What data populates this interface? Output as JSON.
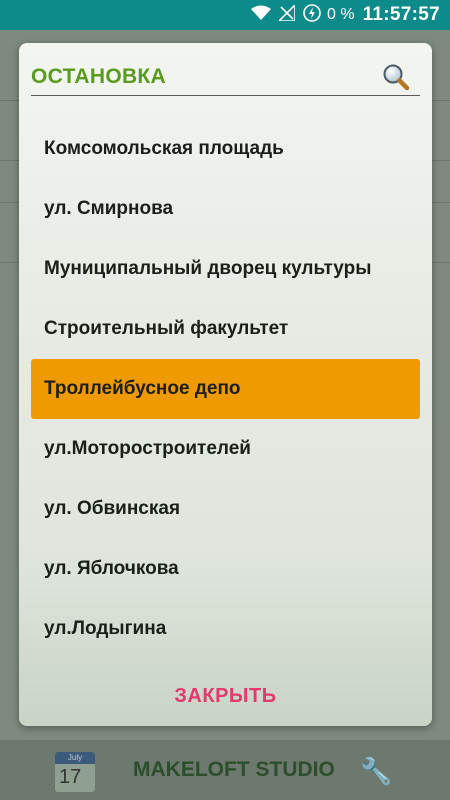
{
  "status_bar": {
    "battery_percent": "0 %",
    "time": "11:57:57"
  },
  "dialog": {
    "title": "ОСТАНОВКА",
    "stops": [
      {
        "label": "Комсомольская площадь",
        "selected": false
      },
      {
        "label": "ул. Смирнова",
        "selected": false
      },
      {
        "label": "Муниципальный дворец культуры",
        "selected": false
      },
      {
        "label": "Строительный факультет",
        "selected": false
      },
      {
        "label": "Троллейбусное депо",
        "selected": true
      },
      {
        "label": "ул.Моторостроителей",
        "selected": false
      },
      {
        "label": "ул. Обвинская",
        "selected": false
      },
      {
        "label": "ул. Яблочкова",
        "selected": false
      },
      {
        "label": "ул.Лодыгина",
        "selected": false
      }
    ],
    "close_label": "ЗАКРЫТЬ"
  },
  "background": {
    "calendar_month": "July",
    "calendar_day": "17",
    "brand": "MAKELOFT STUDIO"
  },
  "colors": {
    "status_bar": "#0d8a8a",
    "title_green": "#5a9a1e",
    "selected_orange": "#ee9a00",
    "close_pink": "#e23a6e"
  }
}
